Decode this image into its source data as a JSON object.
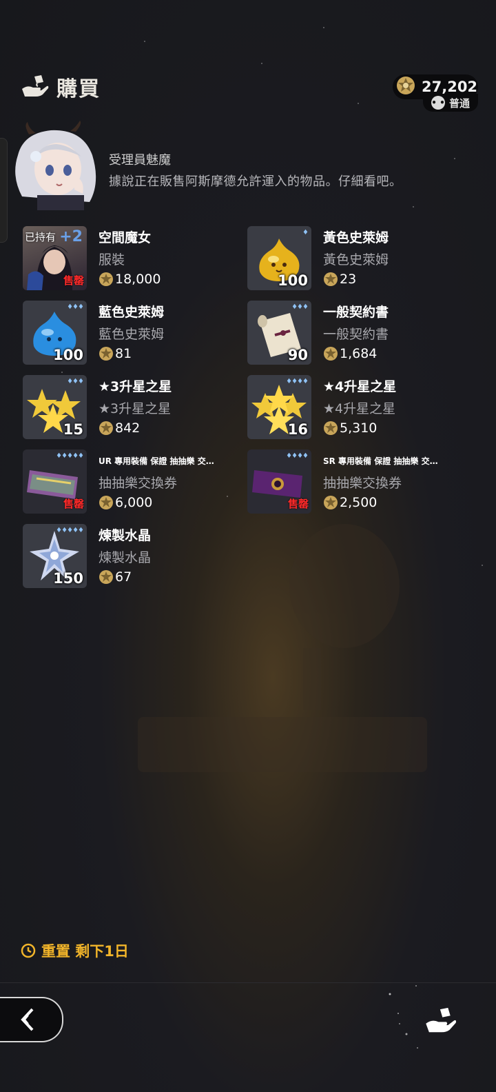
{
  "header": {
    "title": "購買",
    "icon": "hand-bag-icon"
  },
  "currency": {
    "amount": "27,202",
    "tier_label": "普通"
  },
  "npc": {
    "name": "受理員魅魔",
    "dialogue": "據說正在販售阿斯摩德允許運入的物品。仔細看吧。"
  },
  "items": [
    {
      "name": "空間魔女",
      "sub": "服裝",
      "price": "18,000",
      "owned_label": "已持有",
      "plus": "+2",
      "sold_label": "售罄",
      "thumb": "dark-witch"
    },
    {
      "name": "黃色史萊姆",
      "sub": "黃色史萊姆",
      "price": "23",
      "qty": "100",
      "gems": "♦",
      "thumb": "yellow-slime"
    },
    {
      "name": "藍色史萊姆",
      "sub": "藍色史萊姆",
      "price": "81",
      "qty": "100",
      "gems": "♦♦♦",
      "thumb": "blue-slime"
    },
    {
      "name": "一般契約書",
      "sub": "一般契約書",
      "price": "1,684",
      "qty": "90",
      "gems": "♦♦♦",
      "thumb": "scroll"
    },
    {
      "name": "★3升星之星",
      "sub": "★3升星之星",
      "price": "842",
      "qty": "15",
      "gems": "♦♦♦",
      "thumb": "stars3"
    },
    {
      "name": "★4升星之星",
      "sub": "★4升星之星",
      "price": "5,310",
      "qty": "16",
      "gems": "♦♦♦♦",
      "thumb": "stars4"
    },
    {
      "name": "UR 專用裝備 保證 抽抽樂 交…",
      "sub": "抽抽樂交換券",
      "price": "6,000",
      "sold_label": "售罄",
      "gems": "♦♦♦♦♦",
      "thumb": "ur-ticket"
    },
    {
      "name": "SR 專用裝備 保證 抽抽樂 交…",
      "sub": "抽抽樂交換券",
      "price": "2,500",
      "sold_label": "售罄",
      "gems": "♦♦♦♦",
      "thumb": "sr-ticket"
    },
    {
      "name": "煉製水晶",
      "sub": "煉製水晶",
      "price": "67",
      "qty": "150",
      "gems": "♦♦♦♦♦",
      "thumb": "crystal"
    }
  ],
  "footer": {
    "reset_text": "重置 剩下1日"
  },
  "colors": {
    "accent": "#f2b52a",
    "sold": "#ff2a2a",
    "coin": "#c9a65a"
  }
}
